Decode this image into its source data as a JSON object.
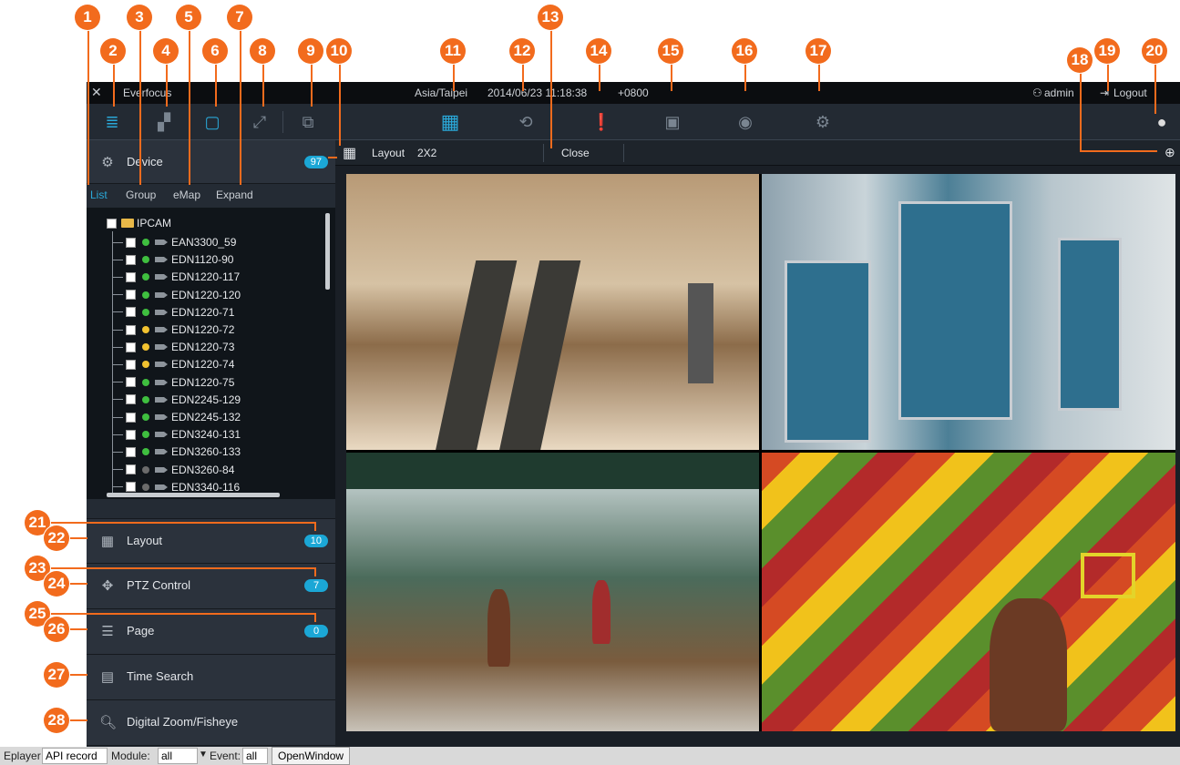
{
  "callouts": [
    "1",
    "2",
    "3",
    "4",
    "5",
    "6",
    "7",
    "8",
    "9",
    "10",
    "11",
    "12",
    "13",
    "14",
    "15",
    "16",
    "17",
    "18",
    "19",
    "20",
    "21",
    "22",
    "23",
    "24",
    "25",
    "26",
    "27",
    "28"
  ],
  "titlebar": {
    "app_name": "Everfocus",
    "timezone": "Asia/Taipei",
    "datetime": "2014/06/23 11:18:38",
    "utc_offset": "+0800",
    "user": "admin",
    "logout": "Logout"
  },
  "toolbar": {
    "left_icons": [
      "list-icon",
      "group-icon",
      "emap-icon",
      "expand-icon",
      "fullscreen-icon"
    ],
    "center_icons": [
      "layout-icon",
      "playback-icon",
      "alarm-icon",
      "event-icon",
      "device-icon",
      "settings-icon"
    ],
    "right_icon": "record-icon"
  },
  "device_panel": {
    "label": "Device",
    "count": "97",
    "tabs": [
      "List",
      "Group",
      "eMap",
      "Expand"
    ],
    "root": "IPCAM",
    "cameras": [
      {
        "name": "EAN3300_59",
        "status": "#3fbf3f"
      },
      {
        "name": "EDN1120-90",
        "status": "#3fbf3f"
      },
      {
        "name": "EDN1220-117",
        "status": "#3fbf3f"
      },
      {
        "name": "EDN1220-120",
        "status": "#3fbf3f"
      },
      {
        "name": "EDN1220-71",
        "status": "#3fbf3f"
      },
      {
        "name": "EDN1220-72",
        "status": "#f2c230"
      },
      {
        "name": "EDN1220-73",
        "status": "#f2c230"
      },
      {
        "name": "EDN1220-74",
        "status": "#f2c230"
      },
      {
        "name": "EDN1220-75",
        "status": "#3fbf3f"
      },
      {
        "name": "EDN2245-129",
        "status": "#3fbf3f"
      },
      {
        "name": "EDN2245-132",
        "status": "#3fbf3f"
      },
      {
        "name": "EDN3240-131",
        "status": "#3fbf3f"
      },
      {
        "name": "EDN3260-133",
        "status": "#3fbf3f"
      },
      {
        "name": "EDN3260-84",
        "status": "#6b6b6b"
      },
      {
        "name": "EDN3340-116",
        "status": "#6b6b6b"
      }
    ]
  },
  "panels": {
    "layout": {
      "label": "Layout",
      "count": "10"
    },
    "ptz": {
      "label": "PTZ Control",
      "count": "7"
    },
    "page": {
      "label": "Page",
      "count": "0"
    },
    "time_search": {
      "label": "Time Search"
    },
    "zoom": {
      "label": "Digital Zoom/Fisheye"
    }
  },
  "viewbar": {
    "layout_label": "Layout",
    "layout_value": "2X2",
    "close": "Close"
  },
  "bottombar": {
    "eplayer_label": "Eplayer",
    "eplayer_value": "API record",
    "module_label": "Module:",
    "module_value": "all",
    "event_label": "Event:",
    "event_value": "all",
    "open_window": "OpenWindow"
  },
  "colors": {
    "accent": "#1ba7d6",
    "callout": "#f26b1d"
  }
}
